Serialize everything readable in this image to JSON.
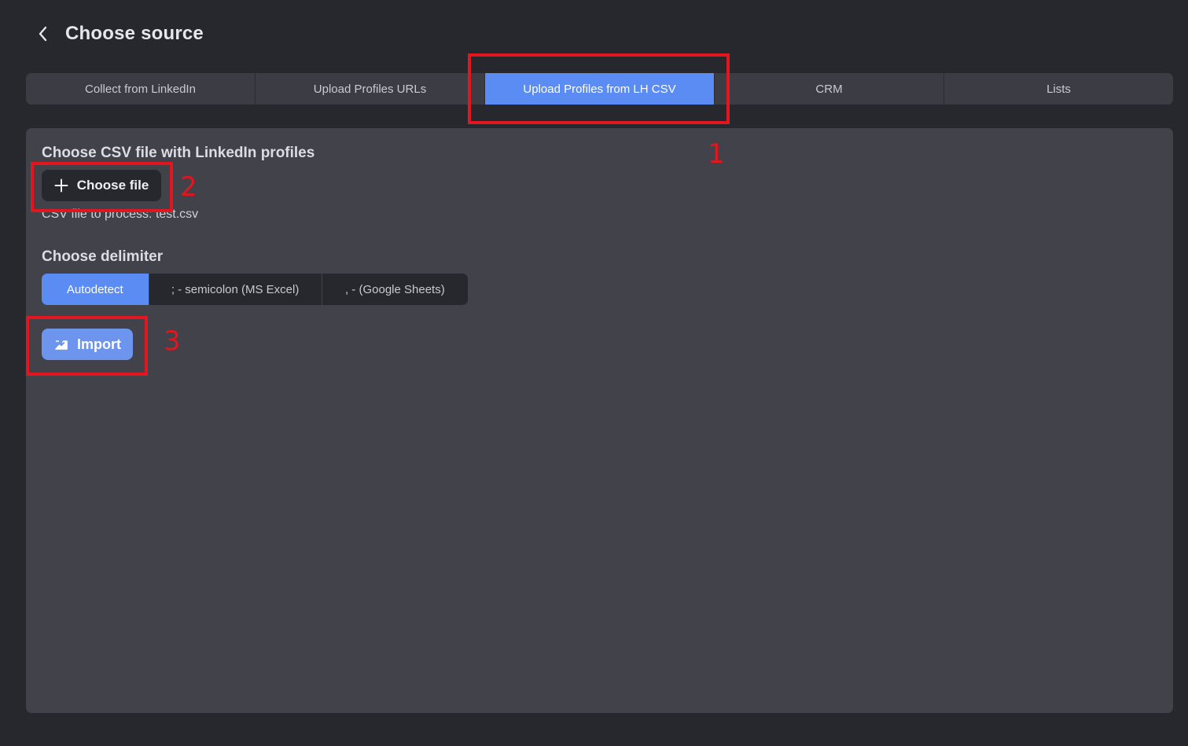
{
  "header": {
    "back_icon": "chevron-left-icon",
    "title": "Choose source"
  },
  "tabs": [
    {
      "label": "Collect from LinkedIn",
      "active": false
    },
    {
      "label": "Upload Profiles URLs",
      "active": false
    },
    {
      "label": "Upload Profiles from LH CSV",
      "active": true
    },
    {
      "label": "CRM",
      "active": false
    },
    {
      "label": "Lists",
      "active": false
    }
  ],
  "csv_section": {
    "title": "Choose CSV file with LinkedIn profiles",
    "choose_file_label": "Choose file",
    "choose_file_icon": "plus-icon",
    "file_info": "CSV file to process: test.csv"
  },
  "delimiter_section": {
    "title": "Choose delimiter",
    "options": [
      {
        "label": "Autodetect",
        "active": true
      },
      {
        "label": "; - semicolon (MS Excel)",
        "active": false
      },
      {
        "label": ", - (Google Sheets)",
        "active": false
      }
    ]
  },
  "import_button": {
    "label": "Import",
    "icon": "import-box-icon"
  },
  "annotations": [
    "1",
    "2",
    "3"
  ],
  "colors": {
    "background": "#27282d",
    "panel": "#41424a",
    "accent": "#5b8cf3",
    "annotation": "#e1161e"
  }
}
